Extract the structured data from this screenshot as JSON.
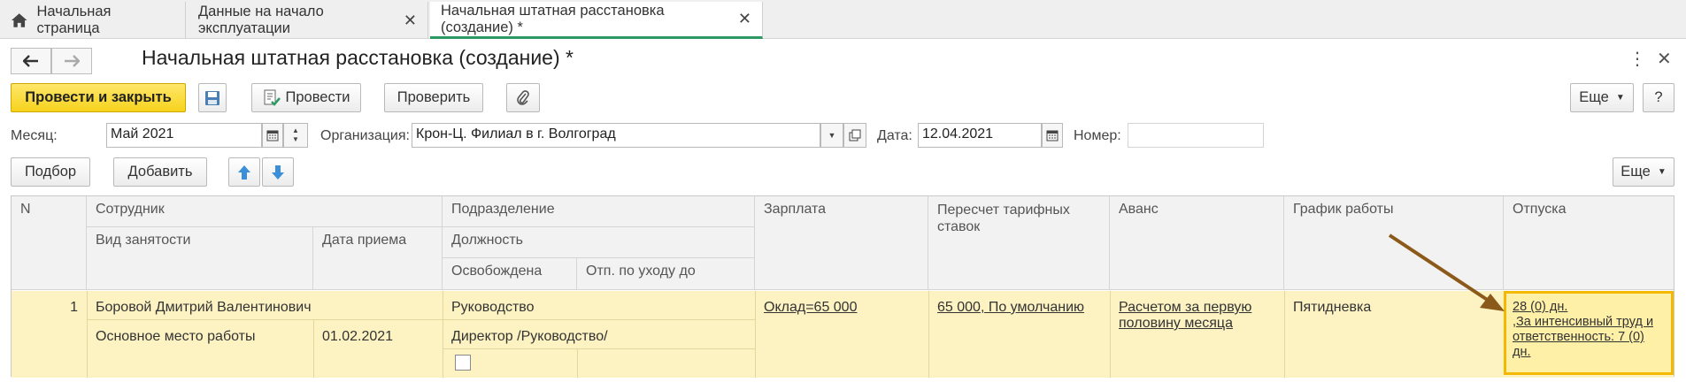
{
  "tabs": [
    {
      "label": "Начальная страница"
    },
    {
      "label": "Данные на начало эксплуатации"
    },
    {
      "label": "Начальная штатная расстановка (создание) *"
    }
  ],
  "header": {
    "title": "Начальная штатная расстановка (создание) *"
  },
  "toolbar": {
    "post_close": "Провести и закрыть",
    "post": "Провести",
    "check": "Проверить",
    "more": "Еще",
    "help": "?"
  },
  "form": {
    "month_label": "Месяц:",
    "month_value": "Май 2021",
    "org_label": "Организация:",
    "org_value": "Крон-Ц. Филиал в г. Волгоград",
    "date_label": "Дата:",
    "date_value": "12.04.2021",
    "number_label": "Номер:",
    "number_value": ""
  },
  "table_toolbar": {
    "select": "Подбор",
    "add": "Добавить",
    "more": "Еще"
  },
  "table": {
    "headers": {
      "n": "N",
      "employee": "Сотрудник",
      "employment_type": "Вид занятости",
      "hire_date": "Дата приема",
      "department": "Подразделение",
      "position": "Должность",
      "released": "Освобождена",
      "parental_leave": "Отп. по уходу до",
      "salary": "Зарплата",
      "rate_recalc": "Пересчет тарифных ставок",
      "advance": "Аванс",
      "schedule": "График работы",
      "vacations": "Отпуска"
    },
    "rows": [
      {
        "n": "1",
        "employee": "Боровой Дмитрий Валентинович",
        "employment_type": "Основное место работы",
        "hire_date": "01.02.2021",
        "department": "Руководство",
        "position": "Директор /Руководство/",
        "salary": "Оклад=65 000",
        "rate_recalc": "65 000, По умолчанию",
        "advance_line1": "Расчетом за первую",
        "advance_line2": "половину месяца",
        "schedule": "Пятидневка",
        "vac_line1": "28 (0) дн.",
        "vac_line2": ",За интенсивный труд и",
        "vac_line3": "ответственность: 7 (0)",
        "vac_line4": "дн."
      }
    ]
  },
  "colors": {
    "accent_tab": "#2e9a63",
    "primary_button": "#f6d21c",
    "row_highlight": "#fdf2c2",
    "cell_border": "#f5b800",
    "arrow": "#8b5a1a"
  }
}
